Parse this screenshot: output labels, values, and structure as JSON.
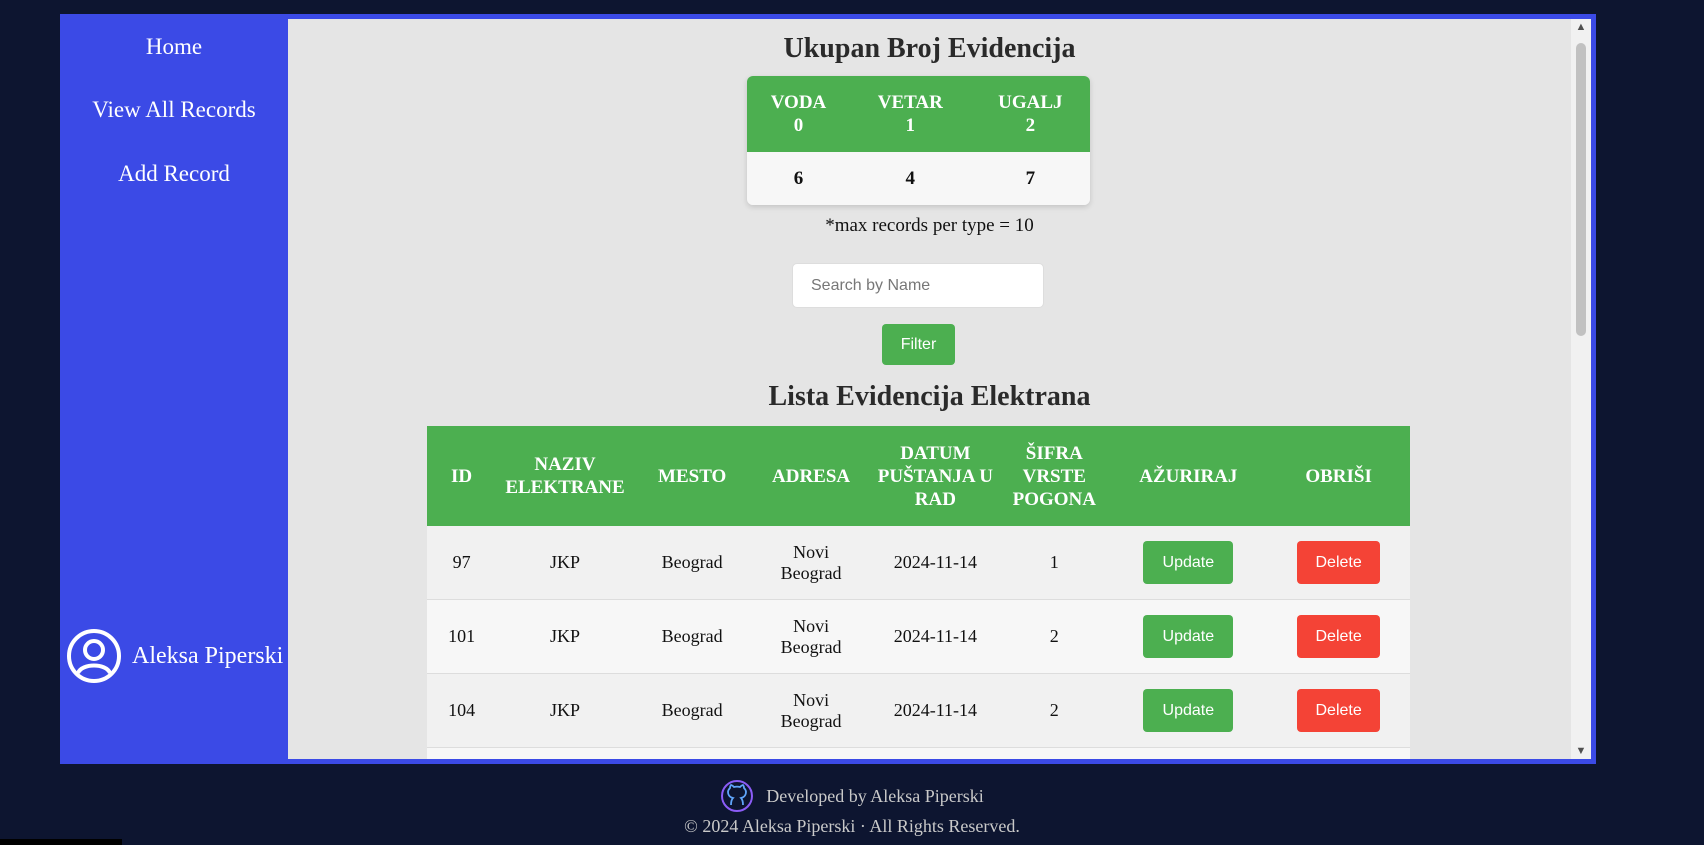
{
  "sidebar": {
    "nav": [
      "Home",
      "View All Records",
      "Add Record"
    ],
    "user_name": "Aleksa Piperski"
  },
  "summary": {
    "title": "Ukupan Broj Evidencija",
    "headers": [
      {
        "name": "VODA",
        "code": "0"
      },
      {
        "name": "VETAR",
        "code": "1"
      },
      {
        "name": "UGALJ",
        "code": "2"
      }
    ],
    "counts": [
      "6",
      "4",
      "7"
    ],
    "note": "*max records per type = 10"
  },
  "search": {
    "placeholder": "Search by Name",
    "filter_label": "Filter"
  },
  "records": {
    "title": "Lista Evidencija Elektrana",
    "columns": [
      "ID",
      "NAZIV ELEKTRANE",
      "MESTO",
      "ADRESA",
      "DATUM PUŠTANJA U RAD",
      "ŠIFRA VRSTE POGONA",
      "AŽURIRAJ",
      "OBRIŠI"
    ],
    "rows": [
      {
        "id": "97",
        "naziv": "JKP",
        "mesto": "Beograd",
        "adresa": "Novi Beograd",
        "datum": "2024-11-14",
        "sifra": "1"
      },
      {
        "id": "101",
        "naziv": "JKP",
        "mesto": "Beograd",
        "adresa": "Novi Beograd",
        "datum": "2024-11-14",
        "sifra": "2"
      },
      {
        "id": "104",
        "naziv": "JKP",
        "mesto": "Beograd",
        "adresa": "Novi Beograd",
        "datum": "2024-11-14",
        "sifra": "2"
      }
    ],
    "update_label": "Update",
    "delete_label": "Delete"
  },
  "footer": {
    "developed_by": "Developed by Aleksa Piperski",
    "copyright": "© 2024 Aleksa Piperski · All Rights Reserved."
  },
  "colors": {
    "sidebar_bg": "#3b4ae6",
    "header_green": "#4caf50",
    "delete_red": "#f44336",
    "page_bg": "#0d1530"
  },
  "icons": [
    "user-circle-icon",
    "github-icon",
    "scroll-up-arrow-icon",
    "scroll-down-arrow-icon"
  ]
}
